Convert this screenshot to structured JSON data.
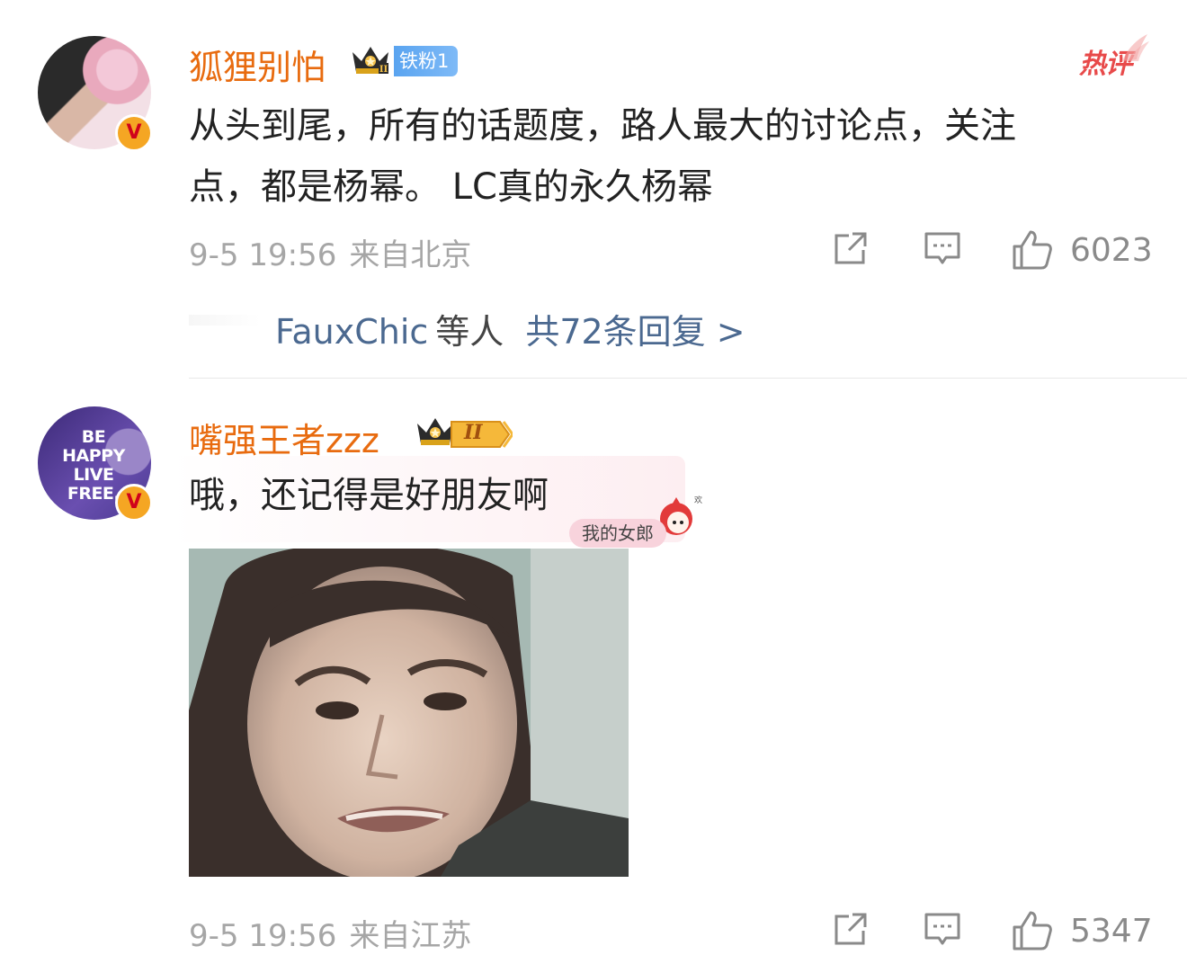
{
  "comments": [
    {
      "username": "狐狸别怕",
      "fan_badge": "铁粉1",
      "hot_tag": "热评",
      "text_line1": "从头到尾，所有的话题度，路人最大的讨论点，关注",
      "text_line2": "点，都是杨幂。 LC真的永久杨幂",
      "time": "9-5 19:56",
      "location": "来自北京",
      "likes": "6023",
      "replies": {
        "user": "FauxChic",
        "mid": "等人",
        "total": "共72条回复 >"
      },
      "vip_level": "II"
    },
    {
      "username": "嘴强王者zzz",
      "avatar_text": "BE\nHAPPY\nLIVE\nFREE.",
      "level_badge": "II",
      "text": "哦，还记得是好朋友啊",
      "sticker_label": "我的女郎",
      "time": "9-5 19:56",
      "location": "来自江苏",
      "likes": "5347"
    }
  ],
  "colors": {
    "username": "#e86b0f",
    "reply_link": "#4b6990",
    "meta": "#a6a6a6",
    "hot_tag": "#e84a4a",
    "fan_badge": "#5aa4f0"
  },
  "icons": [
    "share-icon",
    "comment-icon",
    "thumbs-up-icon",
    "crown-icon",
    "verified-badge-icon"
  ]
}
